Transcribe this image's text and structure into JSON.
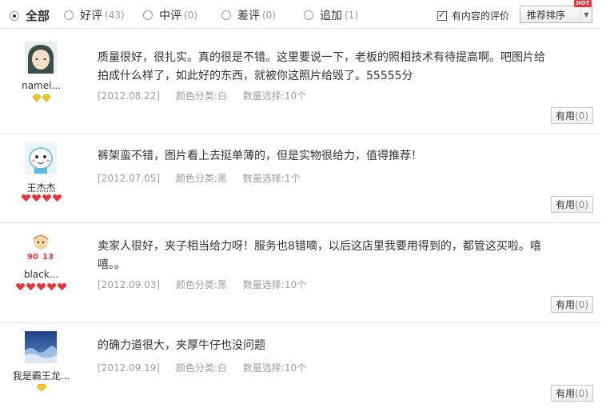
{
  "filters": {
    "all": {
      "label": "全部"
    },
    "good": {
      "label": "好评",
      "count": "(43)"
    },
    "neutral": {
      "label": "中评",
      "count": "(0)"
    },
    "bad": {
      "label": "差评",
      "count": "(0)"
    },
    "append": {
      "label": "追加",
      "count": "(1)"
    },
    "with_content": {
      "label": "有内容的评价",
      "checked": true
    },
    "sort": {
      "label": "推荐排序",
      "badge": "HOT"
    }
  },
  "useful_label": "有用",
  "reviews": [
    {
      "username": "namel...",
      "comment": "质量很好，很扎实。真的很是不错。这里要说一下，老板的照相技术有待提高啊。吧图片给拍成什么样了，如此好的东西，就被你这照片给毁了。55555分",
      "date": "[2012.08.22]",
      "color": "颜色分类:白",
      "quantity": "数量选择:10个",
      "useful_count": "(0)",
      "level_icon": "yellow-diamond",
      "level_count": 2
    },
    {
      "username": "王杰杰",
      "comment": "裤架蛮不错，图片看上去挺单薄的，但是实物很给力，值得推荐！",
      "date": "[2012.07.05]",
      "color": "颜色分类:黑",
      "quantity": "数量选择:1个",
      "useful_count": "(0)",
      "level_icon": "red-heart",
      "level_count": 4
    },
    {
      "username": "black...",
      "comment": "卖家人很好，夹子相当给力呀！服务也8错嘀，以后这店里我要用得到的，都管这买啦。嘻嘻。。",
      "date": "[2012.09.03]",
      "color": "颜色分类:黑",
      "quantity": "数量选择:10个",
      "useful_count": "(0)",
      "level_icon": "red-heart",
      "level_count": 5
    },
    {
      "username": "我是霸王龙...",
      "comment": "的确力道很大，夹厚牛仔也没问题",
      "date": "[2012.09.19]",
      "color": "颜色分类:白",
      "quantity": "数量选择:10个",
      "useful_count": "(0)",
      "level_icon": "yellow-diamond",
      "level_count": 1
    }
  ]
}
